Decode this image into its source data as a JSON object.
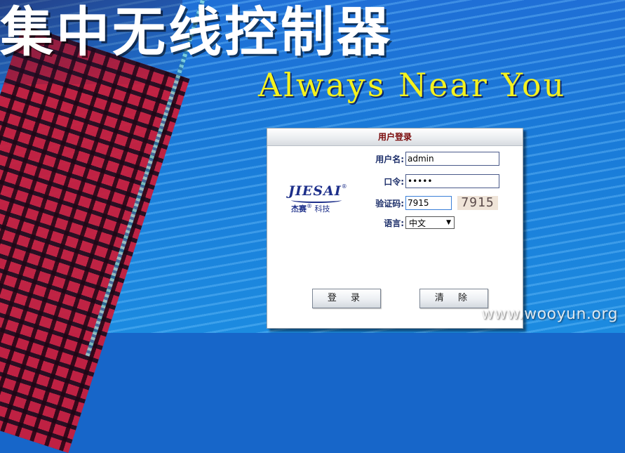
{
  "banner": {
    "title": "集中无线控制器",
    "slogan": "Always Near You"
  },
  "login": {
    "header": "用户登录",
    "logo": {
      "brand": "JIESAI",
      "sub_cn_brand": "杰赛",
      "sub_cn_tech": "科技"
    },
    "username_label": "用户名:",
    "username_value": "admin",
    "password_label": "口令:",
    "password_value": "•••••",
    "captcha_label": "验证码:",
    "captcha_value": "7915",
    "captcha_image_text": "7915",
    "language_label": "语言:",
    "language_selected": "中文",
    "login_button": "登 录",
    "clear_button": "清 除"
  },
  "watermark": "www.wooyun.org",
  "colors": {
    "background_blue": "#1766c9",
    "title_white": "#ffffff",
    "slogan_yellow": "#f4f21e",
    "header_text": "#7a0a0a",
    "label_text": "#1d2f6a"
  }
}
